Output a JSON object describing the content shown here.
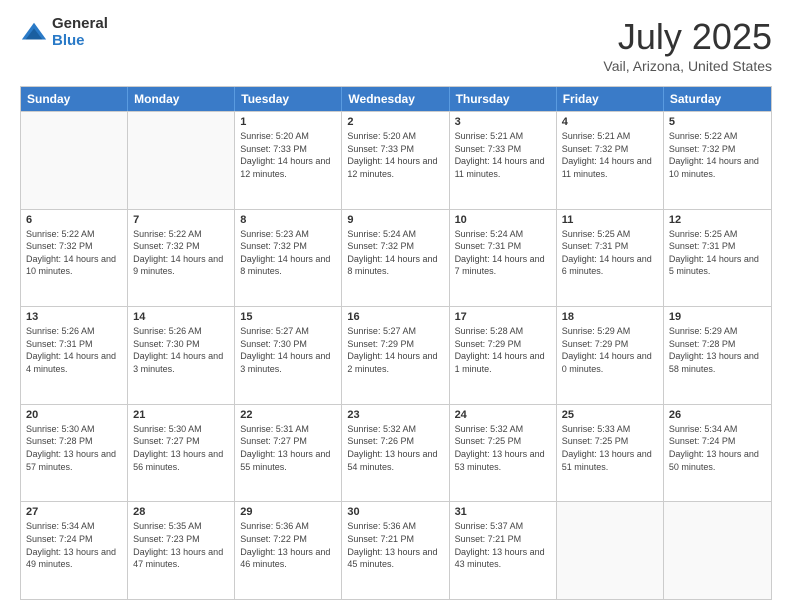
{
  "logo": {
    "general": "General",
    "blue": "Blue"
  },
  "title": "July 2025",
  "subtitle": "Vail, Arizona, United States",
  "days_of_week": [
    "Sunday",
    "Monday",
    "Tuesday",
    "Wednesday",
    "Thursday",
    "Friday",
    "Saturday"
  ],
  "weeks": [
    [
      {
        "day": "",
        "info": ""
      },
      {
        "day": "",
        "info": ""
      },
      {
        "day": "1",
        "info": "Sunrise: 5:20 AM\nSunset: 7:33 PM\nDaylight: 14 hours and 12 minutes."
      },
      {
        "day": "2",
        "info": "Sunrise: 5:20 AM\nSunset: 7:33 PM\nDaylight: 14 hours and 12 minutes."
      },
      {
        "day": "3",
        "info": "Sunrise: 5:21 AM\nSunset: 7:33 PM\nDaylight: 14 hours and 11 minutes."
      },
      {
        "day": "4",
        "info": "Sunrise: 5:21 AM\nSunset: 7:32 PM\nDaylight: 14 hours and 11 minutes."
      },
      {
        "day": "5",
        "info": "Sunrise: 5:22 AM\nSunset: 7:32 PM\nDaylight: 14 hours and 10 minutes."
      }
    ],
    [
      {
        "day": "6",
        "info": "Sunrise: 5:22 AM\nSunset: 7:32 PM\nDaylight: 14 hours and 10 minutes."
      },
      {
        "day": "7",
        "info": "Sunrise: 5:22 AM\nSunset: 7:32 PM\nDaylight: 14 hours and 9 minutes."
      },
      {
        "day": "8",
        "info": "Sunrise: 5:23 AM\nSunset: 7:32 PM\nDaylight: 14 hours and 8 minutes."
      },
      {
        "day": "9",
        "info": "Sunrise: 5:24 AM\nSunset: 7:32 PM\nDaylight: 14 hours and 8 minutes."
      },
      {
        "day": "10",
        "info": "Sunrise: 5:24 AM\nSunset: 7:31 PM\nDaylight: 14 hours and 7 minutes."
      },
      {
        "day": "11",
        "info": "Sunrise: 5:25 AM\nSunset: 7:31 PM\nDaylight: 14 hours and 6 minutes."
      },
      {
        "day": "12",
        "info": "Sunrise: 5:25 AM\nSunset: 7:31 PM\nDaylight: 14 hours and 5 minutes."
      }
    ],
    [
      {
        "day": "13",
        "info": "Sunrise: 5:26 AM\nSunset: 7:31 PM\nDaylight: 14 hours and 4 minutes."
      },
      {
        "day": "14",
        "info": "Sunrise: 5:26 AM\nSunset: 7:30 PM\nDaylight: 14 hours and 3 minutes."
      },
      {
        "day": "15",
        "info": "Sunrise: 5:27 AM\nSunset: 7:30 PM\nDaylight: 14 hours and 3 minutes."
      },
      {
        "day": "16",
        "info": "Sunrise: 5:27 AM\nSunset: 7:29 PM\nDaylight: 14 hours and 2 minutes."
      },
      {
        "day": "17",
        "info": "Sunrise: 5:28 AM\nSunset: 7:29 PM\nDaylight: 14 hours and 1 minute."
      },
      {
        "day": "18",
        "info": "Sunrise: 5:29 AM\nSunset: 7:29 PM\nDaylight: 14 hours and 0 minutes."
      },
      {
        "day": "19",
        "info": "Sunrise: 5:29 AM\nSunset: 7:28 PM\nDaylight: 13 hours and 58 minutes."
      }
    ],
    [
      {
        "day": "20",
        "info": "Sunrise: 5:30 AM\nSunset: 7:28 PM\nDaylight: 13 hours and 57 minutes."
      },
      {
        "day": "21",
        "info": "Sunrise: 5:30 AM\nSunset: 7:27 PM\nDaylight: 13 hours and 56 minutes."
      },
      {
        "day": "22",
        "info": "Sunrise: 5:31 AM\nSunset: 7:27 PM\nDaylight: 13 hours and 55 minutes."
      },
      {
        "day": "23",
        "info": "Sunrise: 5:32 AM\nSunset: 7:26 PM\nDaylight: 13 hours and 54 minutes."
      },
      {
        "day": "24",
        "info": "Sunrise: 5:32 AM\nSunset: 7:25 PM\nDaylight: 13 hours and 53 minutes."
      },
      {
        "day": "25",
        "info": "Sunrise: 5:33 AM\nSunset: 7:25 PM\nDaylight: 13 hours and 51 minutes."
      },
      {
        "day": "26",
        "info": "Sunrise: 5:34 AM\nSunset: 7:24 PM\nDaylight: 13 hours and 50 minutes."
      }
    ],
    [
      {
        "day": "27",
        "info": "Sunrise: 5:34 AM\nSunset: 7:24 PM\nDaylight: 13 hours and 49 minutes."
      },
      {
        "day": "28",
        "info": "Sunrise: 5:35 AM\nSunset: 7:23 PM\nDaylight: 13 hours and 47 minutes."
      },
      {
        "day": "29",
        "info": "Sunrise: 5:36 AM\nSunset: 7:22 PM\nDaylight: 13 hours and 46 minutes."
      },
      {
        "day": "30",
        "info": "Sunrise: 5:36 AM\nSunset: 7:21 PM\nDaylight: 13 hours and 45 minutes."
      },
      {
        "day": "31",
        "info": "Sunrise: 5:37 AM\nSunset: 7:21 PM\nDaylight: 13 hours and 43 minutes."
      },
      {
        "day": "",
        "info": ""
      },
      {
        "day": "",
        "info": ""
      }
    ]
  ]
}
